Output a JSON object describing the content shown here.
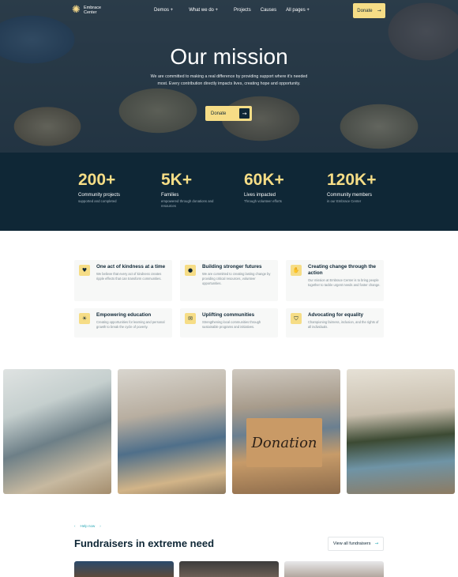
{
  "brand": {
    "name": "Embrace Center",
    "accent": "#f6dd86",
    "dark": "#0f2736"
  },
  "nav": {
    "items": [
      "Demos +",
      "What we do +",
      "Projects",
      "Causes",
      "All pages +"
    ],
    "donate_label": "Donate",
    "donate_icon": "arrow-right-icon"
  },
  "hero": {
    "title": "Our mission",
    "subtitle": "We are committed to making a real difference by providing support where it's needed most. Every contribution directly impacts lives, creating hope and opportunity.",
    "button_label": "Donate"
  },
  "stats": [
    {
      "value": "200+",
      "label": "Community projects",
      "desc": "supported and completed"
    },
    {
      "value": "5K+",
      "label": "Families",
      "desc": "empowered through donations and resources"
    },
    {
      "value": "60K+",
      "label": "Lives impacted",
      "desc": "Through volunteer efforts"
    },
    {
      "value": "120K+",
      "label": "Community members",
      "desc": "in our Embrace Center"
    }
  ],
  "features": [
    {
      "title": "One act of kindness at a time",
      "desc": "We believe that every act of kindness creates ripple effects that can transform communities.",
      "icon": "heart-icon"
    },
    {
      "title": "Building stronger futures",
      "desc": "We are committed to creating lasting change by providing critical resources, volunteer opportunities.",
      "icon": "person-icon"
    },
    {
      "title": "Creating change through the action",
      "desc": "Our mission at Embrace Center is to bring people together to tackle urgent needs and foster change.",
      "icon": "hands-icon"
    },
    {
      "title": "Empowering education",
      "desc": "Creating opportunities for learning and personal growth to break the cycle of poverty.",
      "icon": "sun-icon"
    },
    {
      "title": "Uplifting communities",
      "desc": "Strengthening local communities through sustainable programs and initiatives.",
      "icon": "chat-icon"
    },
    {
      "title": "Advocating for equality",
      "desc": "Championing fairness, inclusion, and the rights of all individuals.",
      "icon": "shield-icon"
    }
  ],
  "photos": {
    "sign_text": "Donation"
  },
  "fundraisers": {
    "eyebrow": "Help now",
    "title": "Fundraisers in extreme need",
    "view_all_label": "View all fundraisers"
  }
}
